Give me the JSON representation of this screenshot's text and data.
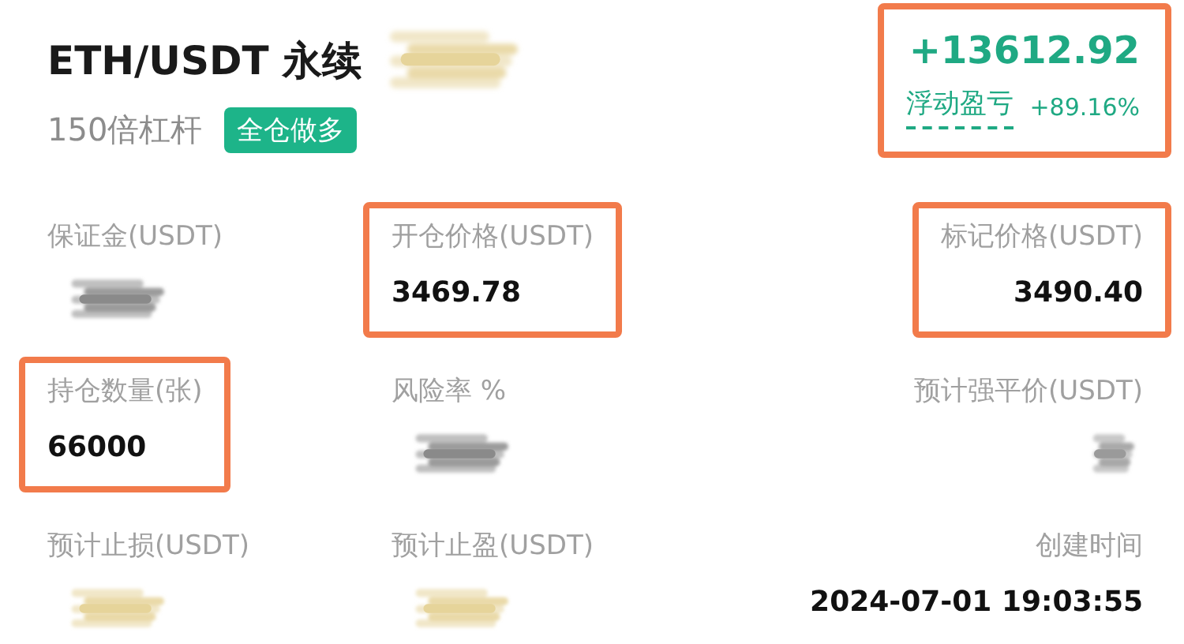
{
  "header": {
    "title": "ETH/USDT 永续",
    "title_smudge": {
      "color": "#e6d49a"
    },
    "leverage": "150倍杠杆",
    "position_tag": "全仓做多"
  },
  "pnl": {
    "amount": "+13612.92",
    "label": "浮动盈亏",
    "percent": "+89.16%",
    "highlighted": true
  },
  "fields": [
    {
      "label": "保证金(USDT)",
      "kind": "redacted",
      "color": "#8a8a8a",
      "highlighted": false
    },
    {
      "label": "开仓价格(USDT)",
      "kind": "value",
      "value": "3469.78",
      "highlighted": true
    },
    {
      "label": "标记价格(USDT)",
      "kind": "value",
      "value": "3490.40",
      "highlighted": true
    },
    {
      "label": "持仓数量(张)",
      "kind": "value",
      "value": "66000",
      "highlighted": true
    },
    {
      "label": "风险率 %",
      "kind": "redacted",
      "color": "#8a8a8a",
      "highlighted": false
    },
    {
      "label": "预计强平价(USDT)",
      "kind": "redacted",
      "color": "#9a9a9a",
      "highlighted": false
    },
    {
      "label": "预计止损(USDT)",
      "kind": "redacted",
      "color": "#e6d49a",
      "highlighted": false
    },
    {
      "label": "预计止盈(USDT)",
      "kind": "redacted",
      "color": "#e6d49a",
      "highlighted": false
    },
    {
      "label": "创建时间",
      "kind": "value",
      "value": "2024-07-01 19:03:55",
      "highlighted": false
    }
  ]
}
